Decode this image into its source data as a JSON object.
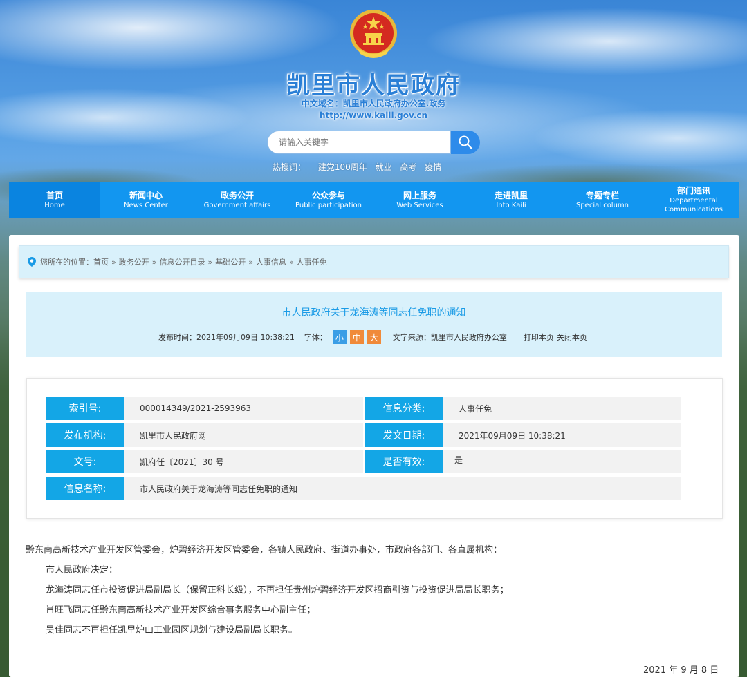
{
  "header": {
    "site_title": "凯里市人民政府",
    "domain_label": "中文域名：凯里市人民政府办公室.政务",
    "url": "http://www.kaili.gov.cn",
    "emblem_icon": "national-emblem-icon"
  },
  "search": {
    "placeholder": "请输入关键字",
    "hot_label": "热搜词：",
    "hot_words": [
      "建党100周年",
      "就业",
      "高考",
      "疫情"
    ]
  },
  "nav": [
    {
      "cn": "首页",
      "en": "Home"
    },
    {
      "cn": "新闻中心",
      "en": "News Center"
    },
    {
      "cn": "政务公开",
      "en": "Government affairs"
    },
    {
      "cn": "公众参与",
      "en": "Public participation"
    },
    {
      "cn": "网上服务",
      "en": "Web Services"
    },
    {
      "cn": "走进凯里",
      "en": "Into Kaili"
    },
    {
      "cn": "专题专栏",
      "en": "Special column"
    },
    {
      "cn": "部门通讯",
      "en": "Departmental Communications"
    }
  ],
  "breadcrumb": {
    "label": "您所在的位置：",
    "items": [
      "首页",
      "政务公开",
      "信息公开目录",
      "基础公开",
      "人事信息",
      "人事任免"
    ],
    "separator": "»"
  },
  "article": {
    "title": "市人民政府关于龙海涛等同志任免职的通知",
    "publish_label": "发布时间：",
    "publish_time": "2021年09月09日 10:38:21",
    "font_label": "字体：",
    "font_sizes": [
      "小",
      "中",
      "大"
    ],
    "source_label": "文字来源：",
    "source": "凯里市人民政府办公室",
    "print": "打印本页",
    "close": "关闭本页"
  },
  "info": {
    "index_label": "索引号:",
    "index_value": "000014349/2021-2593963",
    "category_label": "信息分类:",
    "category_value": "人事任免",
    "org_label": "发布机构:",
    "org_value": "凯里市人民政府网",
    "date_label": "发文日期:",
    "date_value": "2021年09月09日 10:38:21",
    "doc_label": "文号:",
    "doc_value": "凯府任〔2021〕30 号",
    "valid_label": "是否有效:",
    "valid_value": "是",
    "name_label": "信息名称:",
    "name_value": "市人民政府关于龙海涛等同志任免职的通知"
  },
  "body": {
    "recipients": "黔东南高新技术产业开发区管委会，炉碧经济开发区管委会，各镇人民政府、街道办事处，市政府各部门、各直属机构：",
    "paragraphs": [
      "市人民政府决定：",
      "龙海涛同志任市投资促进局副局长（保留正科长级），不再担任贵州炉碧经济开发区招商引资与投资促进局局长职务；",
      "肖旺飞同志任黔东南高新技术产业开发区综合事务服务中心副主任；",
      "吴佳同志不再担任凯里炉山工业园区规划与建设局副局长职务。"
    ],
    "date": "2021 年 9 月 8 日"
  },
  "colors": {
    "nav_blue": "#1296f0",
    "label_blue": "#13a6e6",
    "title_blue": "#1a9be6",
    "font_small": "#3a9ee6",
    "font_medium": "#f08a3a",
    "font_large": "#f08a3a"
  }
}
